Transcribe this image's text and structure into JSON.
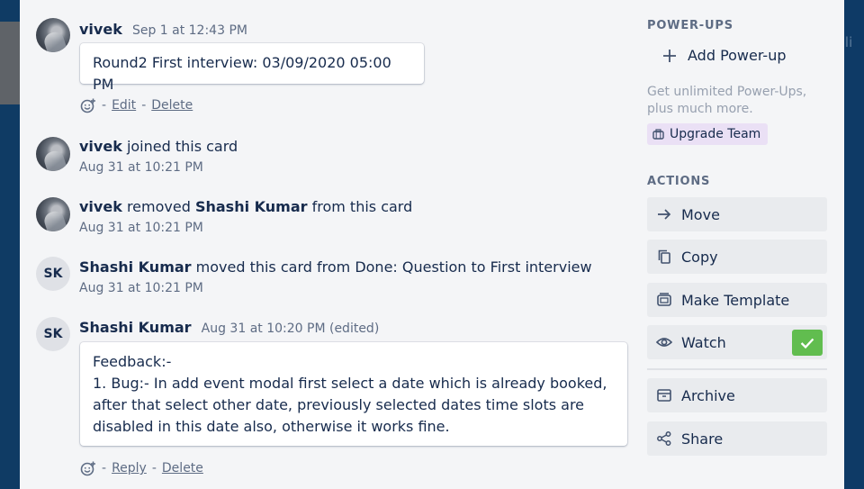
{
  "backdrop": {
    "right_peek_text": "r li"
  },
  "activity": {
    "comment1": {
      "author": "vivek",
      "timestamp": "Sep 1 at 12:43 PM",
      "text": "Round2 First interview: 03/09/2020 05:00 PM",
      "actions": {
        "edit": "Edit",
        "delete": "Delete",
        "sep": "-"
      }
    },
    "event1": {
      "author": "vivek",
      "text": "joined this card",
      "timestamp": "Aug 31 at 10:21 PM"
    },
    "event2": {
      "author": "vivek",
      "text1": "removed",
      "target": "Shashi Kumar",
      "text2": "from this card",
      "timestamp": "Aug 31 at 10:21 PM"
    },
    "event3": {
      "initials": "SK",
      "author": "Shashi Kumar",
      "text": "moved this card from Done: Question to First interview",
      "timestamp": "Aug 31 at 10:21 PM"
    },
    "comment2": {
      "initials": "SK",
      "author": "Shashi Kumar",
      "timestamp": "Aug 31 at 10:20 PM (edited)",
      "lines": [
        "Feedback:-",
        "1. Bug:- In add event modal first select a date which is already booked,",
        "after that select other date, previously selected dates time slots are",
        "disabled in this date also, otherwise it works fine."
      ],
      "actions": {
        "reply": "Reply",
        "delete": "Delete",
        "sep": "-"
      }
    }
  },
  "sidebar": {
    "powerups_title": "POWER-UPS",
    "add_powerup": "Add Power-up",
    "promo": "Get unlimited Power-Ups, plus much more.",
    "upgrade": "Upgrade Team",
    "actions_title": "ACTIONS",
    "buttons": {
      "move": "Move",
      "copy": "Copy",
      "template": "Make Template",
      "watch": "Watch",
      "archive": "Archive",
      "share": "Share"
    },
    "watch_checked": true,
    "check_color": "#61bd4f"
  }
}
